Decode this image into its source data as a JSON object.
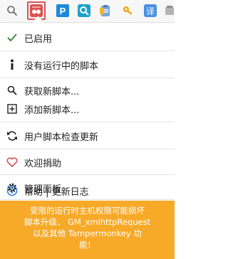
{
  "toolbar": {
    "icons": [
      {
        "name": "search-icon"
      },
      {
        "name": "tampermonkey-icon",
        "active": true
      },
      {
        "name": "p-extension-icon",
        "letter": "P"
      },
      {
        "name": "qr-search-icon"
      },
      {
        "name": "clipboard-icon"
      },
      {
        "name": "key-icon"
      },
      {
        "name": "translate-icon",
        "letter": "译"
      },
      {
        "name": "more-icon"
      }
    ]
  },
  "menu": {
    "items": [
      {
        "label": "已启用",
        "icon": "check-icon"
      },
      {
        "label": "没有运行中的脚本",
        "icon": "info-i-icon"
      },
      {
        "label": "获取新脚本...",
        "icon": "search-icon"
      },
      {
        "label": "添加新脚本...",
        "icon": "plus-box-icon"
      },
      {
        "label": "用户脚本检查更新",
        "icon": "refresh-icon"
      },
      {
        "label": "欢迎捐助",
        "icon": "heart-icon"
      },
      {
        "label": "管理面板",
        "icon": "gear-icon"
      },
      {
        "label": "帮助 | 更新日志",
        "icon": "info-circle-icon"
      }
    ]
  },
  "warning": {
    "line1": "受限的运行时主机权限可能损坏",
    "line2": "脚本升级、 GM_xmlhttpRequest",
    "line3": "以及其他 Tampermonkey 功",
    "line4": "能！"
  },
  "colors": {
    "accent_red": "#d9534f",
    "warning_bg": "#f7a928",
    "check_green": "#3d8b3d",
    "heart_red": "#d9534f",
    "info_blue": "#2a7bd5"
  }
}
